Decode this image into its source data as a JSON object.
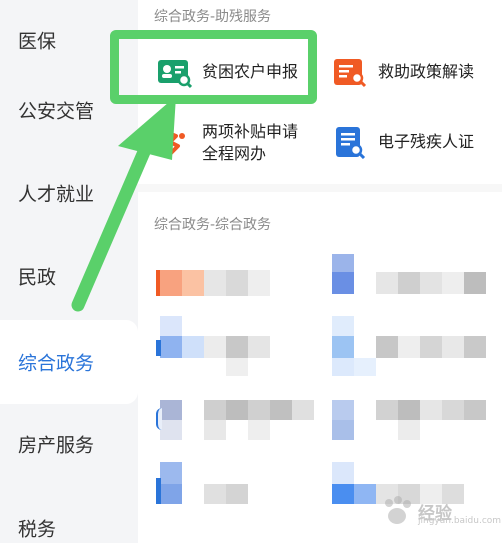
{
  "sidebar": {
    "items": [
      {
        "label": "医保"
      },
      {
        "label": "公安交管"
      },
      {
        "label": "人才就业"
      },
      {
        "label": "民政"
      },
      {
        "label": "综合政务"
      },
      {
        "label": "房产服务"
      },
      {
        "label": "税务"
      }
    ],
    "active_index": 4
  },
  "sections": [
    {
      "title": "综合政务-助残服务",
      "services": [
        {
          "label": "贫困农户申报",
          "icon": "id-card-search-icon",
          "color": "#1aa06c"
        },
        {
          "label": "救助政策解读",
          "icon": "document-search-icon",
          "color": "#f05a24"
        },
        {
          "label_line1": "两项补贴申请",
          "label_line2": "全程网办",
          "icon": "hands-icon",
          "color": "#f05a24"
        },
        {
          "label": "电子残疾人证",
          "icon": "certificate-search-icon",
          "color": "#2a74d9"
        }
      ]
    },
    {
      "title": "综合政务-综合政务"
    }
  ],
  "watermark": {
    "text": "经验",
    "sub": "jingyan.baidu.com"
  },
  "colors": {
    "accent": "#2a74d9",
    "highlight": "#5ad06a",
    "arrow": "#5ad06a"
  }
}
